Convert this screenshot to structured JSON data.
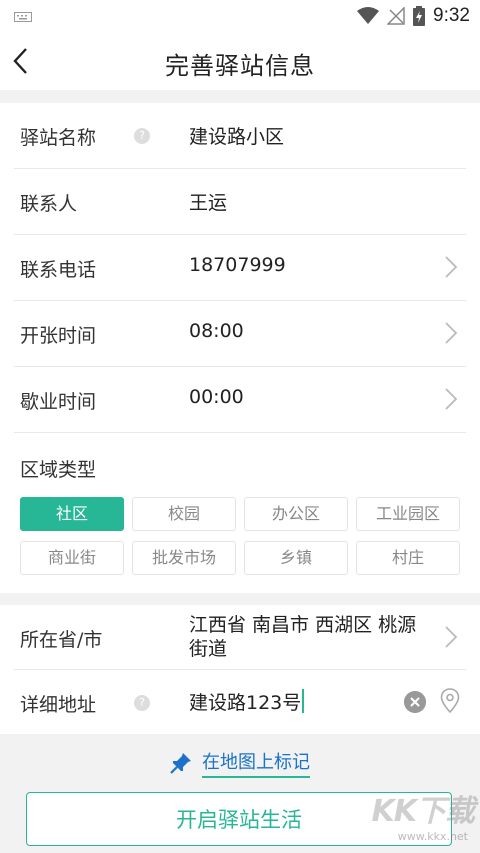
{
  "status_bar": {
    "time": "9:32"
  },
  "header": {
    "title": "完善驿站信息"
  },
  "form": {
    "station_name": {
      "label": "驿站名称",
      "value": "建设路小区"
    },
    "contact": {
      "label": "联系人",
      "value": "王运"
    },
    "phone": {
      "label": "联系电话",
      "value": "18707999"
    },
    "open_time": {
      "label": "开张时间",
      "value": "08:00"
    },
    "close_time": {
      "label": "歇业时间",
      "value": "00:00"
    },
    "region": {
      "label": "区域类型",
      "options": [
        "社区",
        "校园",
        "办公区",
        "工业园区",
        "商业街",
        "批发市场",
        "乡镇",
        "村庄"
      ],
      "selected": "社区"
    },
    "province": {
      "label": "所在省/市",
      "value": "江西省 南昌市 西湖区 桃源街道"
    },
    "address": {
      "label": "详细地址",
      "value": "建设路123号"
    }
  },
  "map_link": "在地图上标记",
  "submit_label": "开启驿站生活",
  "watermark": {
    "main": "KK下载",
    "sub": "www.kkx.net"
  },
  "colors": {
    "accent": "#27b797",
    "link": "#1a73c8"
  }
}
